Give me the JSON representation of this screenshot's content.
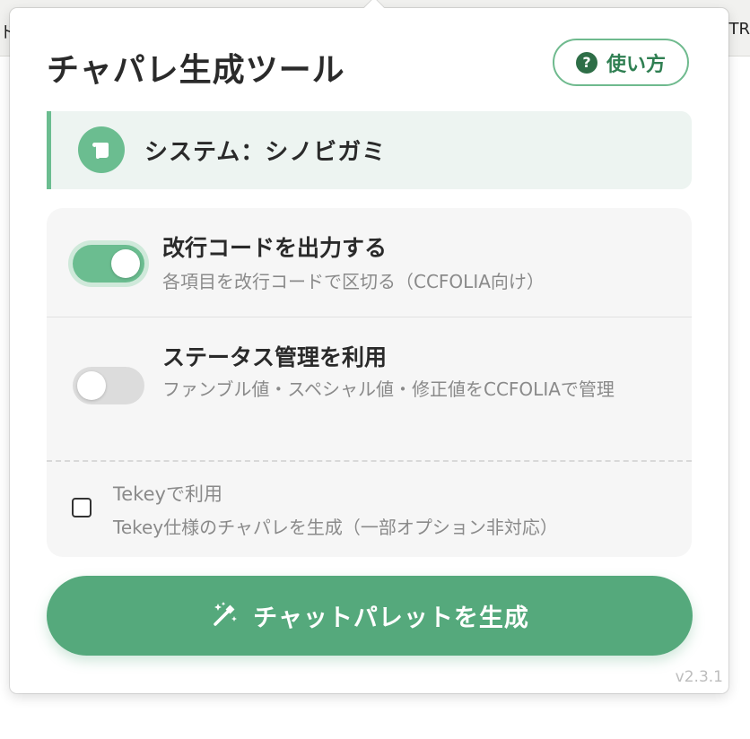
{
  "background": {
    "left_fragment": "ド",
    "right_fragment": "TR"
  },
  "popup": {
    "title": "チャパレ生成ツール",
    "help_button": {
      "icon": "question-circle-icon",
      "icon_glyph": "?",
      "label": "使い方"
    },
    "system": {
      "icon": "scroll-icon",
      "label": "システム：シノビガミ"
    },
    "options": [
      {
        "title": "改行コードを出力する",
        "description": "各項目を改行コードで区切る（CCFOLIA向け）",
        "enabled": true
      },
      {
        "title": "ステータス管理を利用",
        "description": "ファンブル値・スペシャル値・修正値をCCFOLIAで管理",
        "enabled": false
      }
    ],
    "tekey": {
      "title": "Tekeyで利用",
      "description": "Tekey仕様のチャパレを生成（一部オプション非対応）",
      "checked": false
    },
    "generate_button": {
      "icon": "magic-wand-icon",
      "label": "チャットパレットを生成"
    },
    "version": "v2.3.1"
  },
  "colors": {
    "accent": "#55a97c",
    "accent_light": "#6bbd90",
    "help_text": "#2f7f52"
  }
}
